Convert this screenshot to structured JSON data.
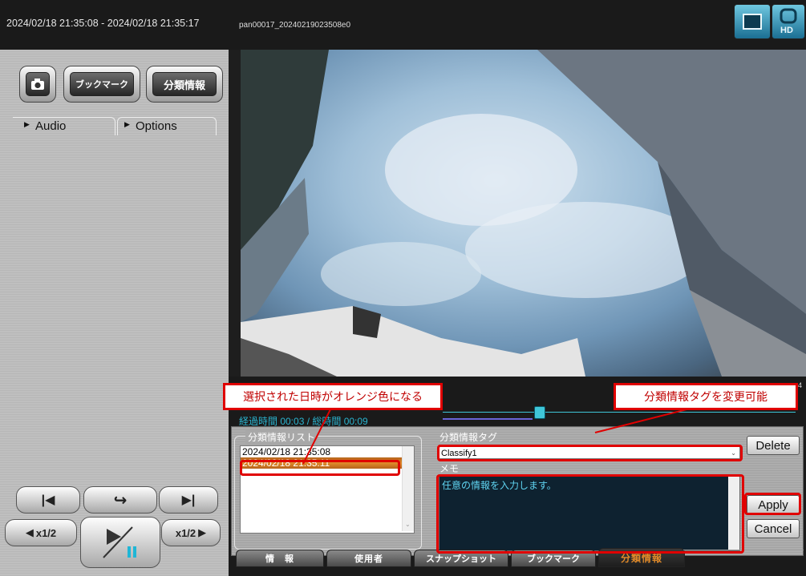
{
  "header": {
    "date_range": "2024/02/18 21:35:08 - 2024/02/18 21:35:17",
    "file_name": "pan00017_20240219023508e0"
  },
  "left_panel": {
    "bookmark_button": "ブックマーク",
    "classify_button": "分類情報",
    "audio_tab": "Audio",
    "options_tab": "Options",
    "speed_slow": "x1/2",
    "speed_fast": "x1/2"
  },
  "timeline": {
    "elapsed": "経過時間 00:03 / 総時間 00:09",
    "edge_digit": "4"
  },
  "classify_panel": {
    "list_title": "分類情報リスト",
    "list_items": [
      "2024/02/18 21:35:08",
      "2024/02/18 21:35:11"
    ],
    "selected_index": 1,
    "tag_label": "分類情報タグ",
    "tag_value": "Classify1",
    "memo_label": "メモ",
    "memo_text": "任意の情報を入力します。",
    "delete_button": "Delete",
    "apply_button": "Apply",
    "cancel_button": "Cancel"
  },
  "callouts": {
    "left": "選択された日時がオレンジ色になる",
    "right": "分類情報タグを変更可能"
  },
  "bottom_tabs": [
    "情　報",
    "使用者",
    "スナップショット",
    "ブックマーク",
    "分類情報"
  ],
  "colors": {
    "accent_orange": "#e08a2a",
    "annotation_red": "#e00000",
    "timeline_cyan": "#3fc6d8"
  }
}
